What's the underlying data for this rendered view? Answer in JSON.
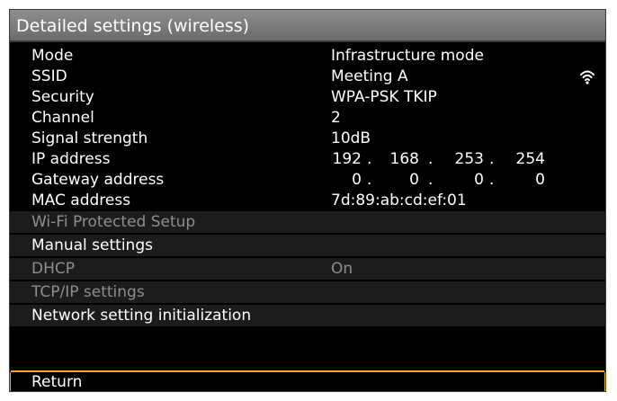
{
  "title": "Detailed settings (wireless)",
  "info": [
    {
      "label": "Mode",
      "value": "Infrastructure mode"
    },
    {
      "label": "SSID",
      "value": "Meeting A"
    },
    {
      "label": "Security",
      "value": "WPA-PSK TKIP"
    },
    {
      "label": "Channel",
      "value": "2"
    },
    {
      "label": "Signal strength",
      "value": "10dB"
    }
  ],
  "ip_address": {
    "label": "IP address",
    "octets": [
      "192",
      "168",
      "253",
      "254"
    ]
  },
  "gateway_address": {
    "label": "Gateway address",
    "octets": [
      "0",
      "0",
      "0",
      "0"
    ]
  },
  "mac_address": {
    "label": "MAC address",
    "value": "7d:89:ab:cd:ef:01"
  },
  "octet_separator": ".",
  "wifi_icon": "wifi-signal-icon",
  "menu": {
    "wps": "Wi-Fi Protected Setup",
    "manual": "Manual settings",
    "dhcp_label": "DHCP",
    "dhcp_value": "On",
    "tcpip": "TCP/IP settings",
    "init": "Network setting initialization",
    "return": "Return"
  },
  "colors": {
    "highlight": "#f5a623",
    "disabled_text": "#8e8e8e",
    "title_bar": "#7d7d7d"
  }
}
